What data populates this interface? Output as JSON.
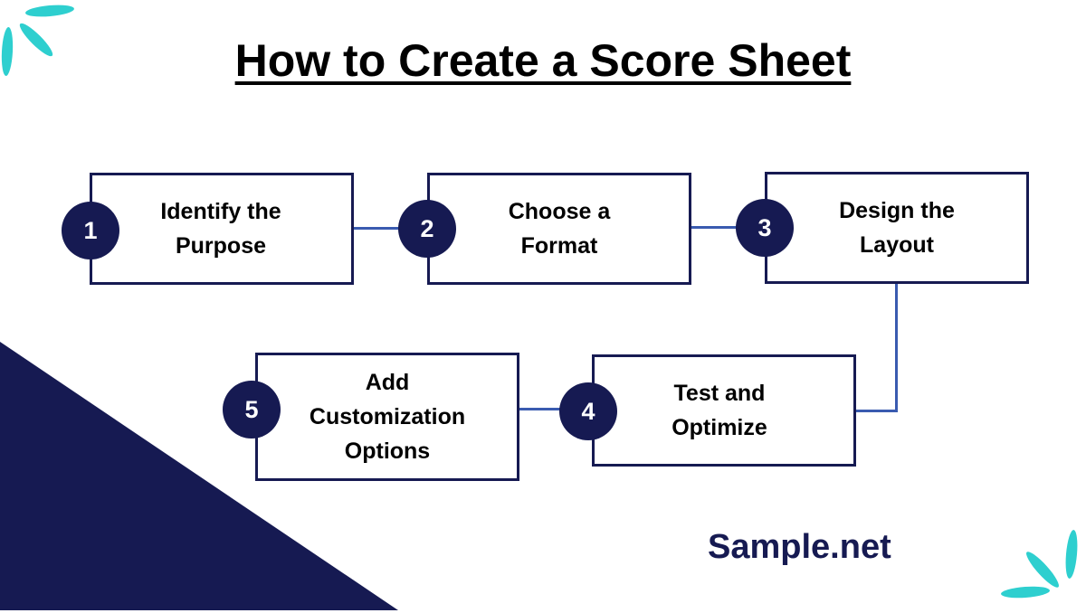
{
  "title": "How to Create a Score Sheet",
  "steps": [
    {
      "number": "1",
      "label": "Identify the\nPurpose"
    },
    {
      "number": "2",
      "label": "Choose a\nFormat"
    },
    {
      "number": "3",
      "label": "Design the\nLayout"
    },
    {
      "number": "4",
      "label": "Test and\nOptimize"
    },
    {
      "number": "5",
      "label": "Add\nCustomization\nOptions"
    }
  ],
  "brand": "Sample.net",
  "colors": {
    "navy": "#161a52",
    "teal": "#2ecfcf",
    "connector": "#3a5bb0"
  }
}
